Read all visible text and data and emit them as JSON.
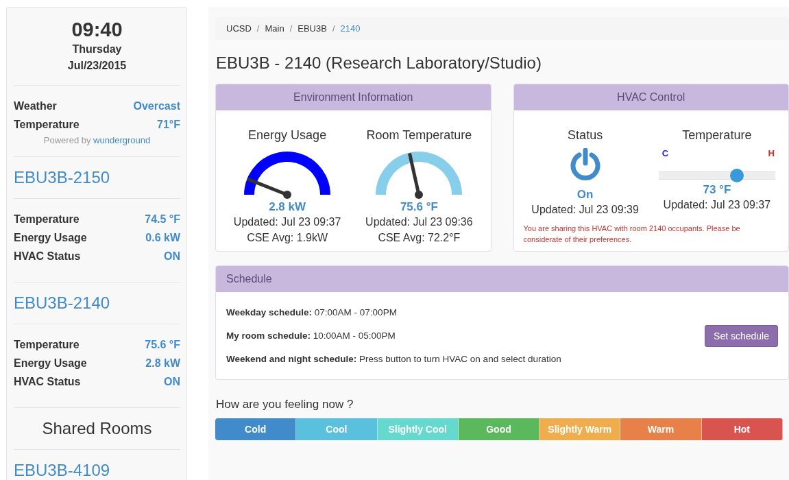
{
  "sidebar": {
    "time": "09:40",
    "day": "Thursday",
    "date": "Jul/23/2015",
    "weather": [
      {
        "label": "Weather",
        "value": "Overcast"
      },
      {
        "label": "Temperature",
        "value": "71°F"
      }
    ],
    "powered_by": {
      "text": "Powered by",
      "link": "wunderground"
    },
    "rooms": [
      {
        "name": "EBU3B-2150",
        "rows": [
          {
            "label": "Temperature",
            "value": "74.5 °F"
          },
          {
            "label": "Energy Usage",
            "value": "0.6 kW"
          },
          {
            "label": "HVAC Status",
            "value": "ON"
          }
        ]
      },
      {
        "name": "EBU3B-2140",
        "rows": [
          {
            "label": "Temperature",
            "value": "75.6 °F"
          },
          {
            "label": "Energy Usage",
            "value": "2.8 kW"
          },
          {
            "label": "HVAC Status",
            "value": "ON"
          }
        ]
      }
    ],
    "shared_heading": "Shared Rooms",
    "shared_rooms": [
      {
        "name": "EBU3B-4109"
      }
    ]
  },
  "breadcrumb_separator": "/",
  "breadcrumb": [
    {
      "label": "UCSD",
      "selected": false
    },
    {
      "label": "Main",
      "selected": false
    },
    {
      "label": "EBU3B",
      "selected": false
    },
    {
      "label": "2140",
      "selected": true
    }
  ],
  "page_title": "EBU3B - 2140 (Research Laboratory/Studio)",
  "environment": {
    "title": "Environment Information",
    "gauges": [
      {
        "title": "Energy Usage",
        "level": 0.12,
        "color": "#0000ff",
        "reading": "2.8 kW",
        "updated": "Updated: Jul 23 09:37",
        "average": "CSE Avg: 1.9kW"
      },
      {
        "title": "Room Temperature",
        "level": 0.43,
        "color": "#87ceeb",
        "reading": "75.6 °F",
        "updated": "Updated: Jul 23 09:36",
        "average": "CSE Avg: 72.2°F"
      }
    ]
  },
  "hvac": {
    "title": "HVAC Control",
    "status": {
      "title": "Status",
      "on": true,
      "label": "On",
      "updated": "Updated: Jul 23 09:39"
    },
    "temperature": {
      "title": "Temperature",
      "cold_label": "C",
      "hot_label": "H",
      "level": 0.67,
      "reading": "73 °F",
      "updated": "Updated: Jul 23 09:37"
    },
    "notice": "You are sharing this HVAC with room 2140 occupants. Please be considerate of their preferences."
  },
  "schedule": {
    "title": "Schedule",
    "lines": [
      "**Weekday schedule:** 07:00AM - 07:00PM",
      "**My room schedule:** 10:00AM - 05:00PM",
      "**Weekend and night schedule:** Press button to turn HVAC on and select duration"
    ],
    "button": "Set schedule"
  },
  "feeling": {
    "question": "How are you feeling now ?",
    "options": [
      {
        "label": "Cold",
        "color": "#428bca"
      },
      {
        "label": "Cool",
        "color": "#5bc0de"
      },
      {
        "label": "Slightly Cool",
        "color": "#66d9cf"
      },
      {
        "label": "Good",
        "color": "#5cb85c"
      },
      {
        "label": "Slightly Warm",
        "color": "#f0ad4e"
      },
      {
        "label": "Warm",
        "color": "#e8804a"
      },
      {
        "label": "Hot",
        "color": "#d9534f"
      }
    ]
  }
}
